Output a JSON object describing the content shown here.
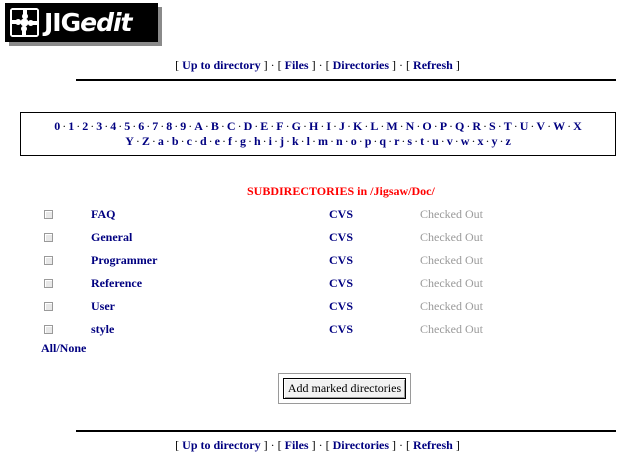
{
  "logo": {
    "text_bold": "JIG",
    "text_italic": "edit"
  },
  "nav": {
    "up": "Up to directory",
    "files": "Files",
    "directories": "Directories",
    "refresh": "Refresh"
  },
  "alphabet": {
    "row1": [
      "0",
      "1",
      "2",
      "3",
      "4",
      "5",
      "6",
      "7",
      "8",
      "9",
      "A",
      "B",
      "C",
      "D",
      "E",
      "F",
      "G",
      "H",
      "I",
      "J",
      "K",
      "L",
      "M",
      "N",
      "O",
      "P",
      "Q",
      "R",
      "S",
      "T",
      "U",
      "V",
      "W",
      "X"
    ],
    "row2": [
      "Y",
      "Z",
      "a",
      "b",
      "c",
      "d",
      "e",
      "f",
      "g",
      "h",
      "i",
      "j",
      "k",
      "l",
      "m",
      "n",
      "o",
      "p",
      "q",
      "r",
      "s",
      "t",
      "u",
      "v",
      "w",
      "x",
      "y",
      "z"
    ]
  },
  "subdirectories": {
    "title": "SUBDIRECTORIES in /Jigsaw/Doc/",
    "rows": [
      {
        "name": "FAQ",
        "cvs": "CVS",
        "status": "Checked Out"
      },
      {
        "name": "General",
        "cvs": "CVS",
        "status": "Checked Out"
      },
      {
        "name": "Programmer",
        "cvs": "CVS",
        "status": "Checked Out"
      },
      {
        "name": "Reference",
        "cvs": "CVS",
        "status": "Checked Out"
      },
      {
        "name": "User",
        "cvs": "CVS",
        "status": "Checked Out"
      },
      {
        "name": "style",
        "cvs": "CVS",
        "status": "Checked Out"
      }
    ],
    "all_none": "All/None",
    "add_button": "Add marked directories"
  }
}
